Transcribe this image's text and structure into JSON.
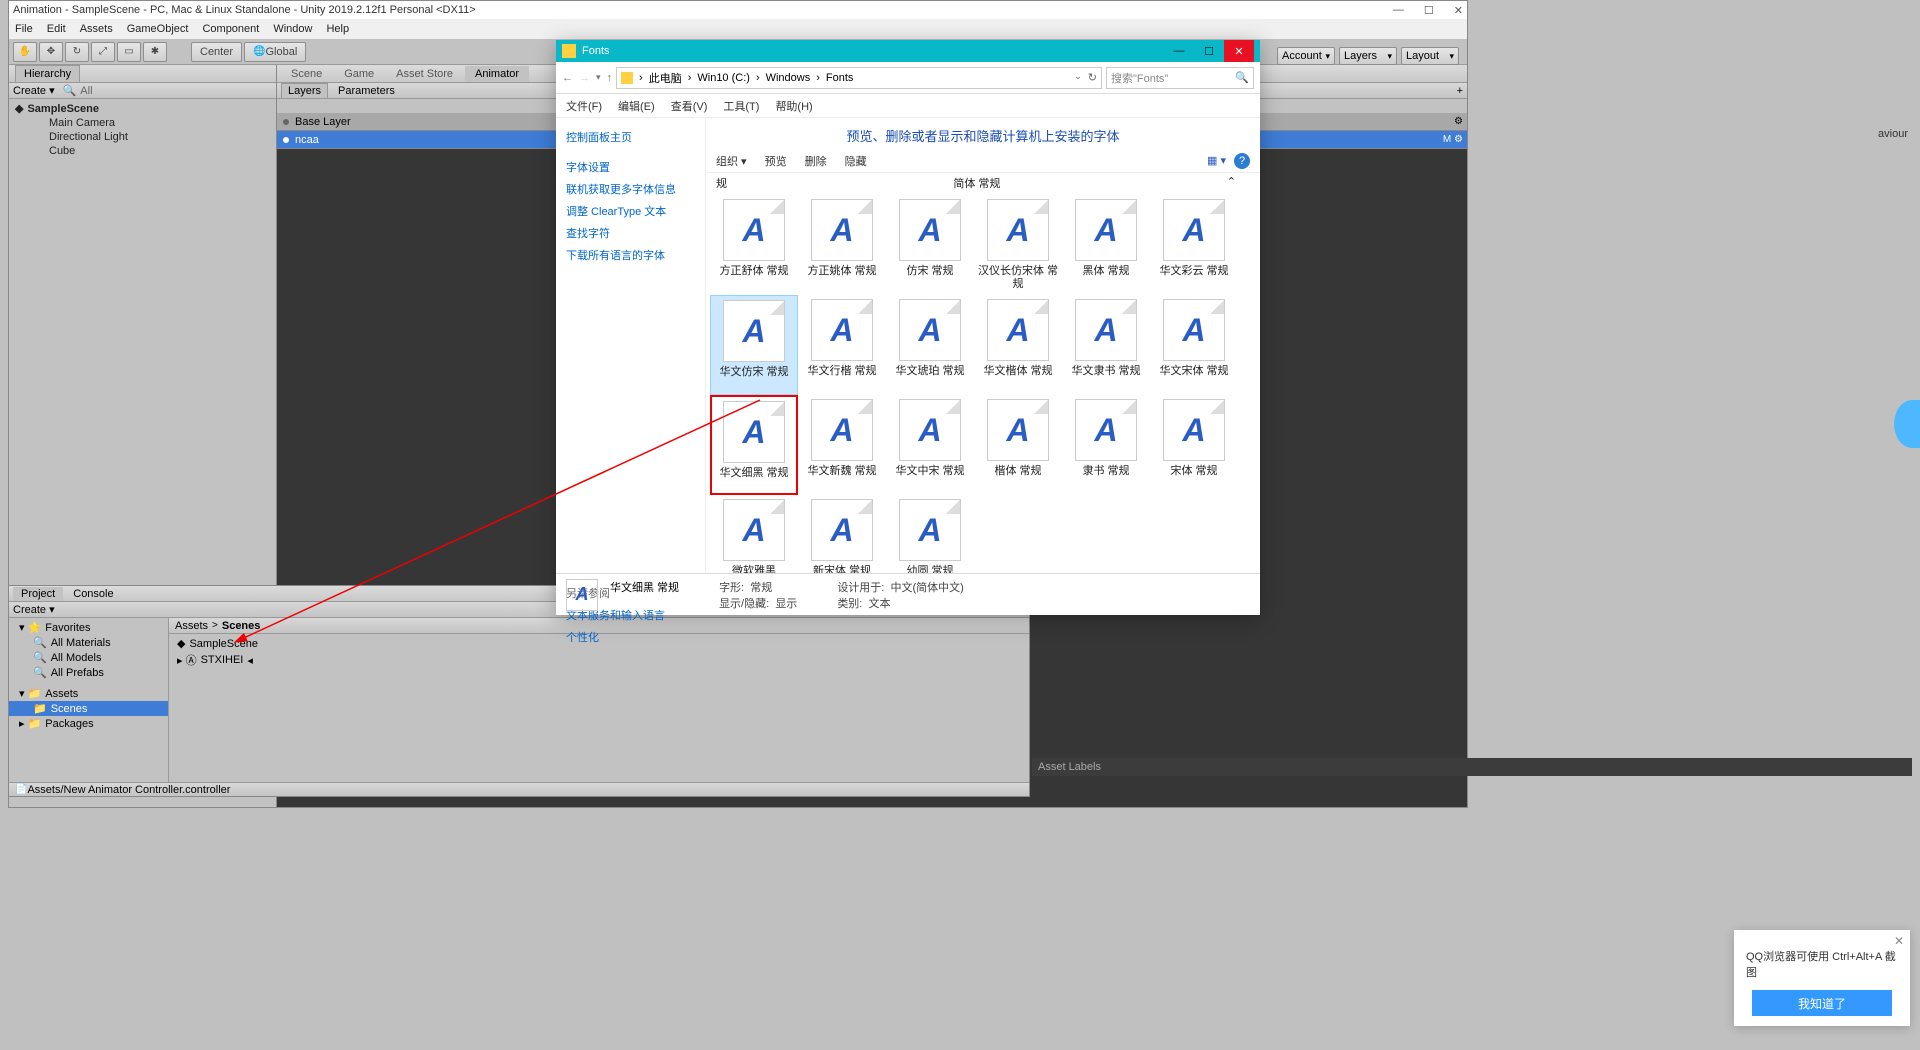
{
  "unity": {
    "title": "Animation - SampleScene - PC, Mac & Linux Standalone - Unity 2019.2.12f1 Personal <DX11>",
    "menu": [
      "File",
      "Edit",
      "Assets",
      "GameObject",
      "Component",
      "Window",
      "Help"
    ],
    "toolbar": {
      "center": "Center",
      "global": "Global"
    },
    "dropdowns": {
      "account": "Account",
      "layers": "Layers",
      "layout": "Layout"
    },
    "hierarchy": {
      "tab": "Hierarchy",
      "create": "Create ▾",
      "search_hint": "All",
      "scene": "SampleScene",
      "items": [
        "Main Camera",
        "Directional Light",
        "Cube"
      ]
    },
    "sceneTabs": [
      "Scene",
      "Game",
      "Asset Store",
      "Animator"
    ],
    "subTabs": {
      "layers": "Layers",
      "parameters": "Parameters"
    },
    "layers": [
      {
        "name": "Base Layer",
        "icons": "⚙"
      },
      {
        "name": "ncaa",
        "icons": "M ⚙"
      }
    ],
    "inspector": {
      "behaviour": "aviour"
    },
    "project": {
      "tabs": [
        "Project",
        "Console"
      ],
      "create": "Create ▾",
      "favorites": "Favorites",
      "favItems": [
        "All Materials",
        "All Models",
        "All Prefabs"
      ],
      "assets": "Assets",
      "scenes": "Scenes",
      "packages": "Packages",
      "breadcrumb": [
        "Assets",
        "Scenes"
      ],
      "items": [
        "SampleScene",
        "STXIHEI"
      ],
      "footer": "Assets/New Animator Controller.controller"
    },
    "assetLabels": "Asset Labels"
  },
  "explorer": {
    "title": "Fonts",
    "path": [
      "此电脑",
      "Win10 (C:)",
      "Windows",
      "Fonts"
    ],
    "search_hint": "搜索\"Fonts\"",
    "menu": [
      "文件(F)",
      "编辑(E)",
      "查看(V)",
      "工具(T)",
      "帮助(H)"
    ],
    "sidebar": [
      "控制面板主页",
      "字体设置",
      "联机获取更多字体信息",
      "调整 ClearType 文本",
      "查找字符",
      "下载所有语言的字体"
    ],
    "sidebar2": [
      "另请参阅",
      "文本服务和输入语言",
      "个性化"
    ],
    "heading": "预览、删除或者显示和隐藏计算机上安装的字体",
    "toolbar": [
      "组织 ▾",
      "预览",
      "删除",
      "隐藏"
    ],
    "topLeft": "规",
    "topRight": "简体 常规",
    "fonts": [
      [
        "方正舒体 常规",
        "方正姚体 常规",
        "仿宋 常规",
        "汉仪长仿宋体 常规",
        "黑体 常规",
        "华文彩云 常规"
      ],
      [
        "华文仿宋 常规",
        "华文行楷 常规",
        "华文琥珀 常规",
        "华文楷体 常规",
        "华文隶书 常规",
        "华文宋体 常规"
      ],
      [
        "华文细黑 常规",
        "华文新魏 常规",
        "华文中宋 常规",
        "楷体 常规",
        "隶书 常规",
        "宋体 常规"
      ],
      [
        "微软雅黑",
        "新宋体 常规",
        "幼圆 常规"
      ]
    ],
    "details": {
      "name": "华文细黑 常规",
      "style_label": "字形:",
      "style": "常规",
      "show_label": "显示/隐藏:",
      "show": "显示",
      "design_label": "设计用于:",
      "design": "中文(简体中文)",
      "cat_label": "类别:",
      "cat": "文本"
    }
  },
  "popup": {
    "text": "QQ浏览器可使用 Ctrl+Alt+A 截图",
    "btn": "我知道了"
  }
}
